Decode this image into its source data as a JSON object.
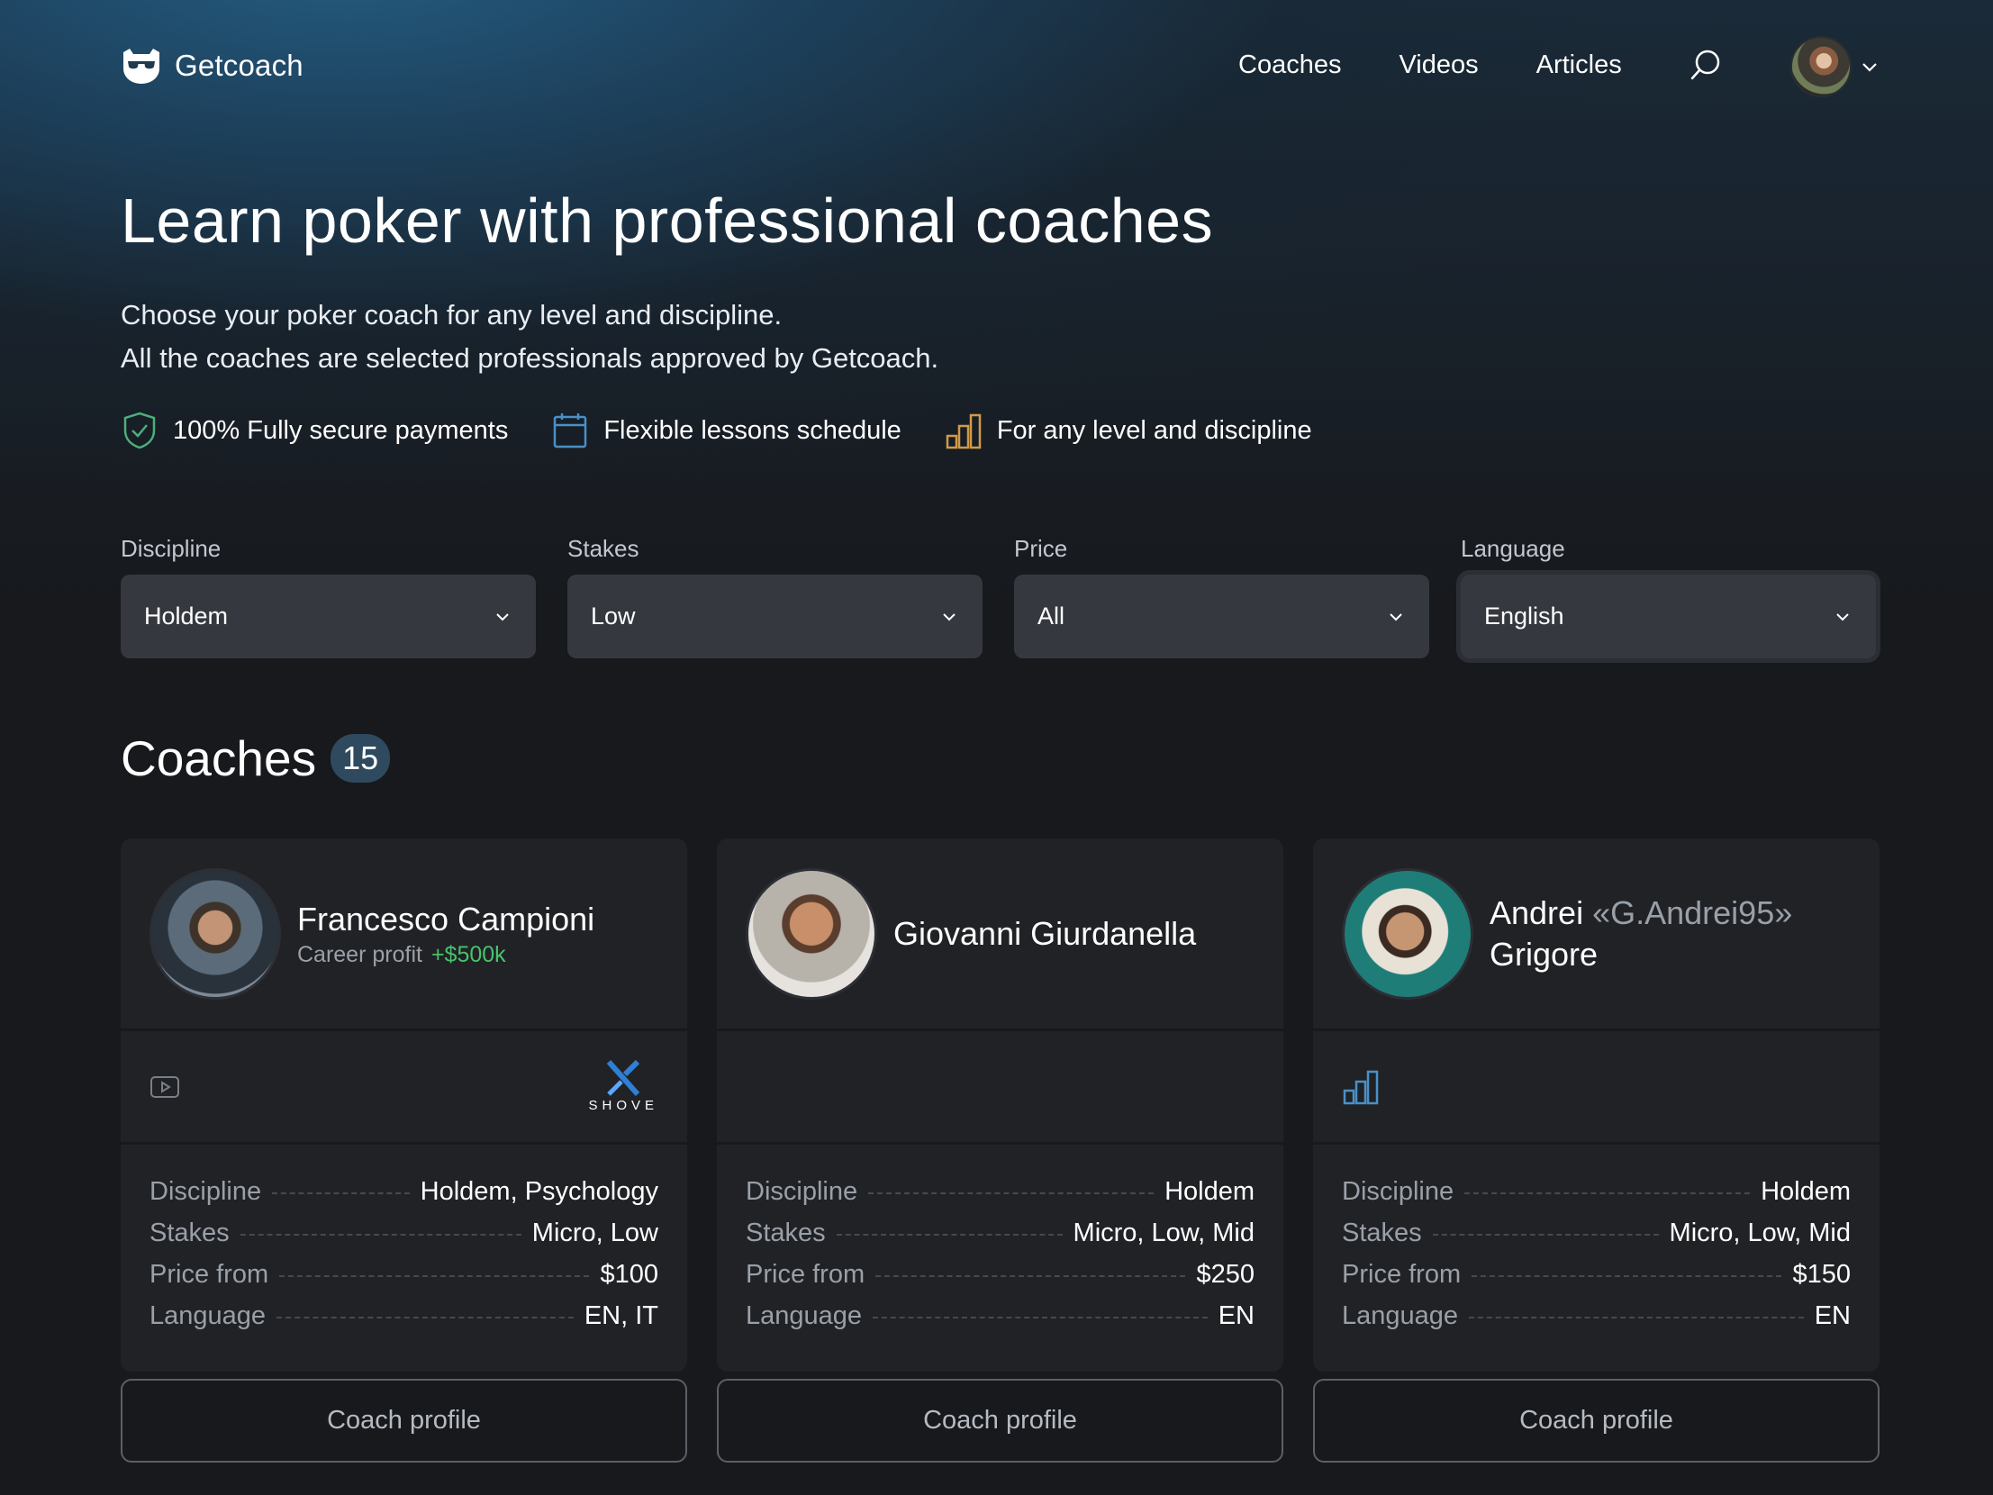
{
  "header": {
    "logo_text": "Getcoach",
    "nav": [
      "Coaches",
      "Videos",
      "Articles"
    ]
  },
  "hero": {
    "title": "Learn poker with professional coaches",
    "subtitle_line1": "Choose your poker coach for any level and discipline.",
    "subtitle_line2": "All the coaches are selected professionals approved by Getcoach.",
    "features": [
      {
        "icon": "shield-check-icon",
        "label": "100% Fully secure payments"
      },
      {
        "icon": "calendar-icon",
        "label": "Flexible lessons schedule"
      },
      {
        "icon": "bar-chart-icon",
        "label": "For any level and discipline"
      }
    ]
  },
  "filters": [
    {
      "label": "Discipline",
      "value": "Holdem"
    },
    {
      "label": "Stakes",
      "value": "Low"
    },
    {
      "label": "Price",
      "value": "All"
    },
    {
      "label": "Language",
      "value": "English"
    }
  ],
  "coaches_section": {
    "title": "Coaches",
    "count": "15"
  },
  "coaches": [
    {
      "first_name": "Francesco Campioni",
      "nickname": "",
      "last_name": "",
      "profit_label": "Career profit",
      "profit_value": "+$500k",
      "badge_text": "SHOVE",
      "details": [
        {
          "key": "Discipline",
          "value": "Holdem, Psychology"
        },
        {
          "key": "Stakes",
          "value": "Micro, Low"
        },
        {
          "key": "Price from",
          "value": "$100"
        },
        {
          "key": "Language",
          "value": "EN, IT"
        }
      ],
      "button": "Coach profile"
    },
    {
      "first_name": "Giovanni Giurdanella",
      "nickname": "",
      "last_name": "",
      "profit_label": "",
      "profit_value": "",
      "details": [
        {
          "key": "Discipline",
          "value": "Holdem"
        },
        {
          "key": "Stakes",
          "value": "Micro, Low, Mid"
        },
        {
          "key": "Price from",
          "value": "$250"
        },
        {
          "key": "Language",
          "value": "EN"
        }
      ],
      "button": "Coach profile"
    },
    {
      "first_name": "Andrei",
      "nickname": "«G.Andrei95»",
      "last_name": "Grigore",
      "profit_label": "",
      "profit_value": "",
      "details": [
        {
          "key": "Discipline",
          "value": "Holdem"
        },
        {
          "key": "Stakes",
          "value": "Micro, Low, Mid"
        },
        {
          "key": "Price from",
          "value": "$150"
        },
        {
          "key": "Language",
          "value": "EN"
        }
      ],
      "button": "Coach profile"
    }
  ],
  "colors": {
    "accent_green": "#49c26b",
    "brand_blue": "#2f7fd6",
    "feature_green": "#4caf7a",
    "feature_blue": "#4a90c8",
    "feature_orange": "#d19a4a"
  }
}
